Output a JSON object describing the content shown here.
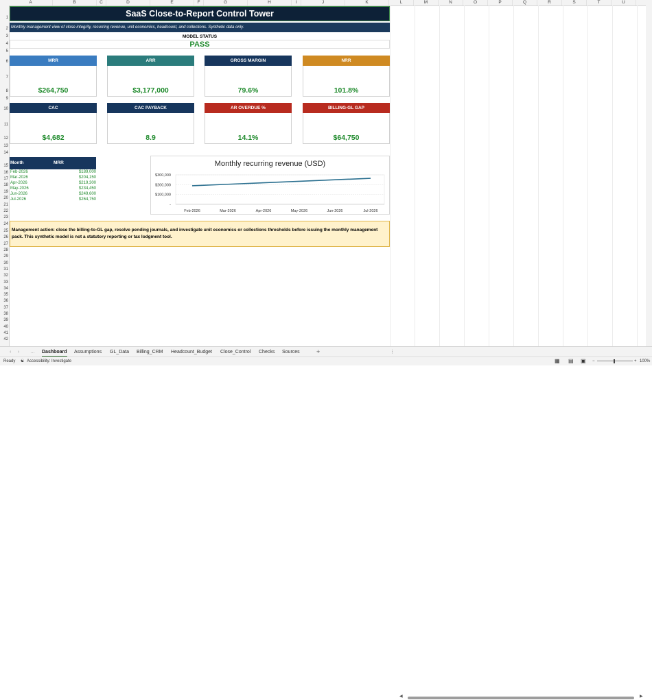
{
  "columns": [
    "A",
    "B",
    "C",
    "D",
    "E",
    "F",
    "G",
    "H",
    "I",
    "J",
    "K",
    "L",
    "M",
    "N",
    "O",
    "P",
    "Q",
    "R",
    "S",
    "T",
    "U"
  ],
  "rows": [
    "1",
    "2",
    "3",
    "4",
    "5",
    "6",
    "7",
    "8",
    "9",
    "10",
    "11",
    "12",
    "13",
    "14",
    "15",
    "16",
    "17",
    "18",
    "19",
    "20",
    "21",
    "22",
    "23",
    "24",
    "25",
    "26",
    "27",
    "28",
    "29",
    "30",
    "31",
    "32",
    "33",
    "34",
    "35",
    "36",
    "37",
    "38",
    "39",
    "40",
    "41",
    "42"
  ],
  "header": {
    "title": "SaaS Close-to-Report Control Tower",
    "subtitle": "Monthly management view of close integrity, recurring revenue, unit economics, headcount, and collections. Synthetic data only."
  },
  "model_status": {
    "label": "MODEL STATUS",
    "value": "PASS"
  },
  "kpis": [
    {
      "label": "MRR",
      "value": "$264,750",
      "color": "#3a7cc0"
    },
    {
      "label": "ARR",
      "value": "$3,177,000",
      "color": "#2b7c7c"
    },
    {
      "label": "GROSS MARGIN",
      "value": "79.6%",
      "color": "#17365d"
    },
    {
      "label": "NRR",
      "value": "101.8%",
      "color": "#cf8a22"
    },
    {
      "label": "CAC",
      "value": "$4,682",
      "color": "#17365d"
    },
    {
      "label": "CAC PAYBACK",
      "value": "8.9",
      "color": "#17365d"
    },
    {
      "label": "AR OVERDUE %",
      "value": "14.1%",
      "color": "#b82b1f"
    },
    {
      "label": "BILLING-GL GAP",
      "value": "$64,750",
      "color": "#b82b1f"
    }
  ],
  "mrr_table": {
    "headers": [
      "Month",
      "MRR"
    ],
    "rows": [
      [
        "Feb-2026",
        "$189,000"
      ],
      [
        "Mar-2026",
        "$204,150"
      ],
      [
        "Apr-2026",
        "$219,300"
      ],
      [
        "May-2026",
        "$234,450"
      ],
      [
        "Jun-2026",
        "$249,600"
      ],
      [
        "Jul-2026",
        "$264,750"
      ]
    ]
  },
  "chart_data": {
    "type": "line",
    "title": "Monthly recurring revenue (USD)",
    "categories": [
      "Feb-2026",
      "Mar-2026",
      "Apr-2026",
      "May-2026",
      "Jun-2026",
      "Jul-2026"
    ],
    "values": [
      189000,
      204150,
      219300,
      234450,
      249600,
      264750
    ],
    "y_ticks": [
      "-",
      "$100,000",
      "$200,000",
      "$300,000"
    ],
    "ylim": [
      0,
      300000
    ],
    "grid": true,
    "line_color": "#2a6f8f"
  },
  "note": "Management action: close the billing-to-GL gap, resolve pending journals, and investigate unit economics or collections thresholds before issuing the monthly management pack. This synthetic model is not a statutory reporting or tax lodgment tool.",
  "tabs": [
    "Dashboard",
    "Assumptions",
    "GL_Data",
    "Billing_CRM",
    "Headcount_Budget",
    "Close_Control",
    "Checks",
    "Sources"
  ],
  "add_sheet": "+",
  "status": {
    "ready": "Ready",
    "accessibility": "Accessibility: Investigate",
    "zoom": "100%"
  }
}
